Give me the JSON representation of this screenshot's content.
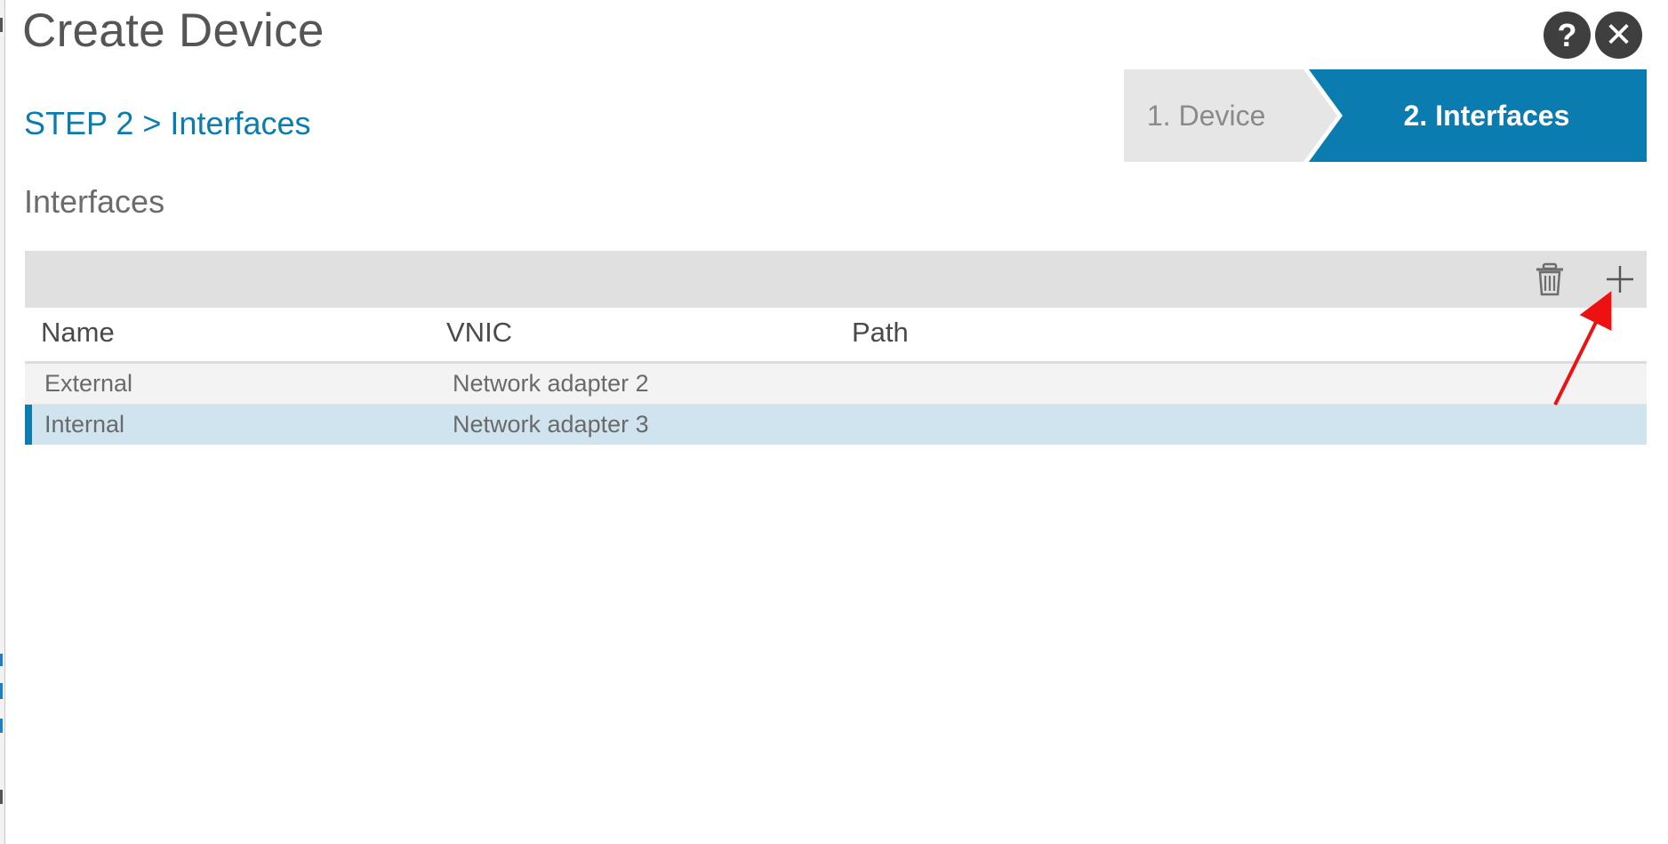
{
  "dialog": {
    "title": "Create Device",
    "help_symbol": "?",
    "close_symbol": "✕"
  },
  "wizard": {
    "steps": [
      {
        "label": "1. Device",
        "active": false
      },
      {
        "label": "2. Interfaces",
        "active": true
      }
    ],
    "accent_color": "#0b7cb0"
  },
  "step_heading": "STEP 2 > Interfaces",
  "section_title": "Interfaces",
  "toolbar": {
    "icons": [
      "trash-icon",
      "plus-icon"
    ]
  },
  "table": {
    "columns": [
      "Name",
      "VNIC",
      "Path"
    ],
    "rows": [
      {
        "name": "External",
        "vnic": "Network adapter 2",
        "path": "",
        "selected": false
      },
      {
        "name": "Internal",
        "vnic": "Network adapter 3",
        "path": "",
        "selected": true
      }
    ]
  },
  "annotation": {
    "arrow_color": "#ee1111",
    "points_to": "plus-icon"
  }
}
